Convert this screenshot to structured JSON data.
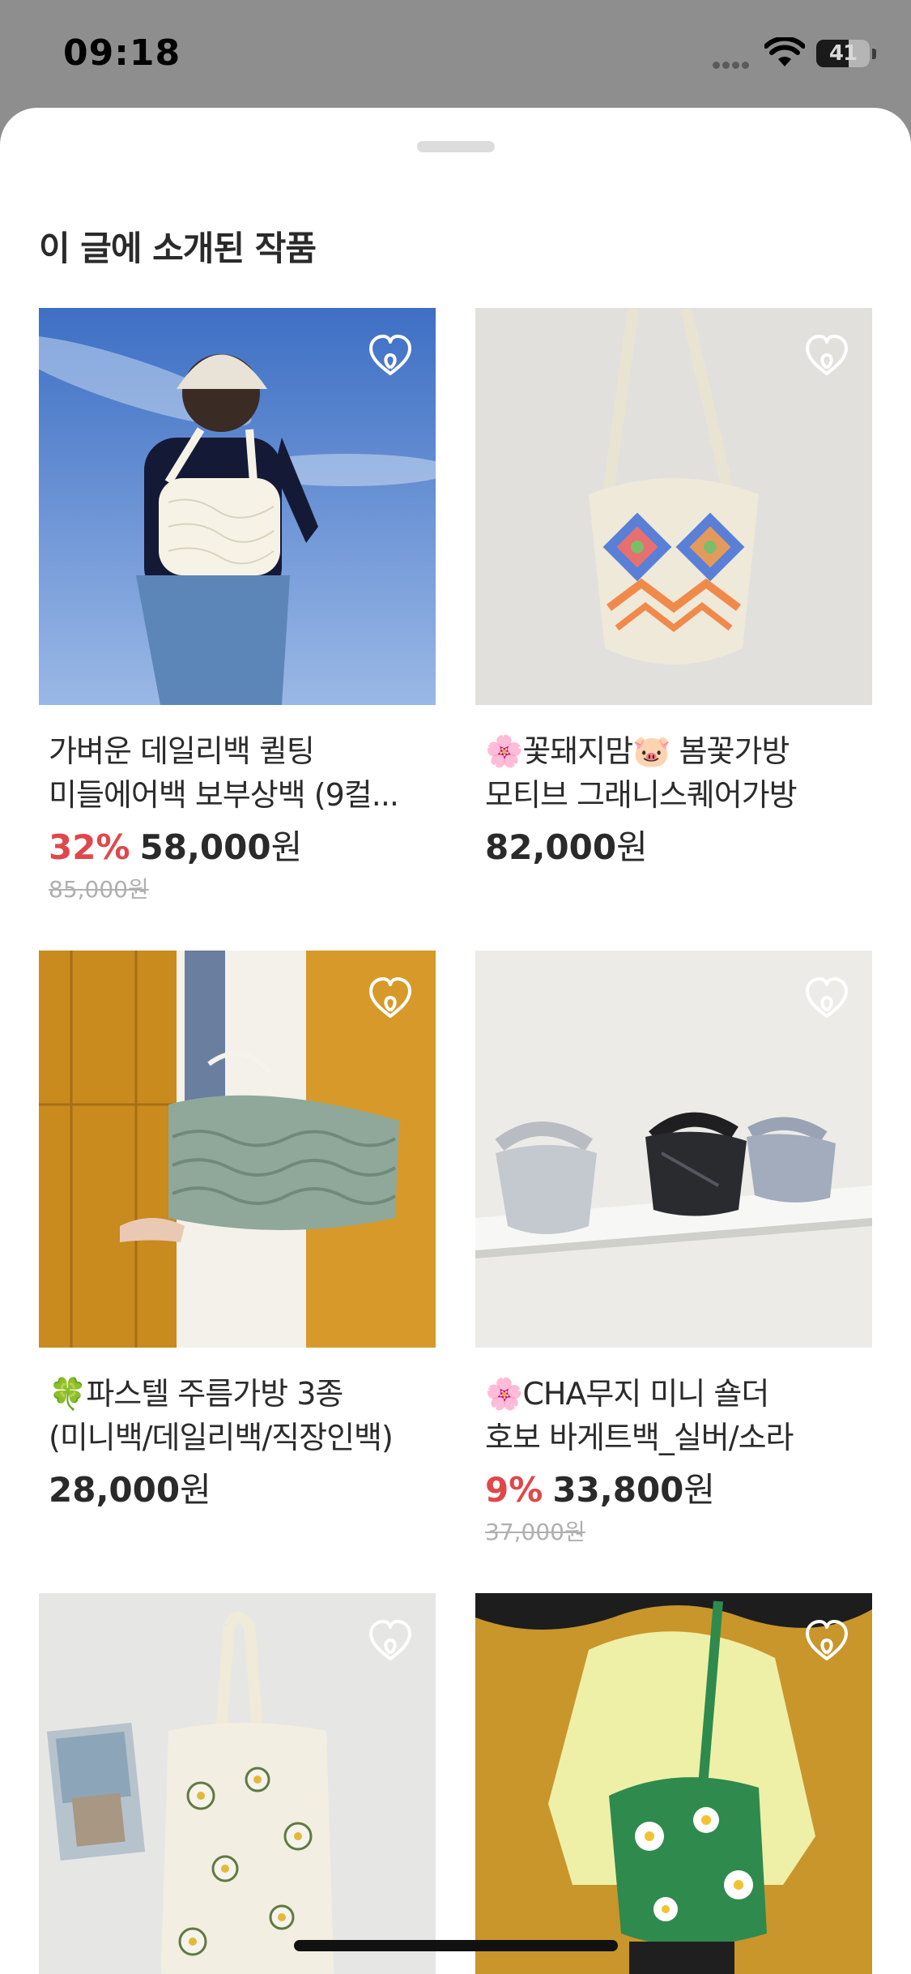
{
  "status_bar": {
    "time": "09:18",
    "battery": "41"
  },
  "sheet": {
    "title": "이 글에 소개된 작품",
    "products": [
      {
        "name_line1": "가벼운 데일리백 퀼팅",
        "name_line2": "미들에어백 보부상백 (9컬...",
        "discount": "32%",
        "price": "58,000",
        "unit": "원",
        "original_price": "85,000원"
      },
      {
        "name_line1": "🌸꽃돼지맘🐷 봄꽃가방",
        "name_line2": "모티브 그래니스퀘어가방",
        "discount": "",
        "price": "82,000",
        "unit": "원",
        "original_price": ""
      },
      {
        "name_line1": "🍀파스텔 주름가방 3종",
        "name_line2": "(미니백/데일리백/직장인백)",
        "discount": "",
        "price": "28,000",
        "unit": "원",
        "original_price": ""
      },
      {
        "name_line1": "🌸CHA무지 미니 숄더",
        "name_line2": "호보 바게트백_실버/소라",
        "discount": "9%",
        "price": "33,800",
        "unit": "원",
        "original_price": "37,000원"
      },
      {
        "name_line1": "",
        "name_line2": "",
        "discount": "",
        "price": "",
        "unit": "",
        "original_price": ""
      },
      {
        "name_line1": "",
        "name_line2": "",
        "discount": "",
        "price": "",
        "unit": "",
        "original_price": ""
      }
    ]
  },
  "icons": {
    "favorite": "heart-outline-icon"
  },
  "colors": {
    "discount": "#e0474a",
    "text": "#2a2a2a",
    "original_price": "#b0b0b0",
    "backdrop": "#8e8e8e"
  }
}
